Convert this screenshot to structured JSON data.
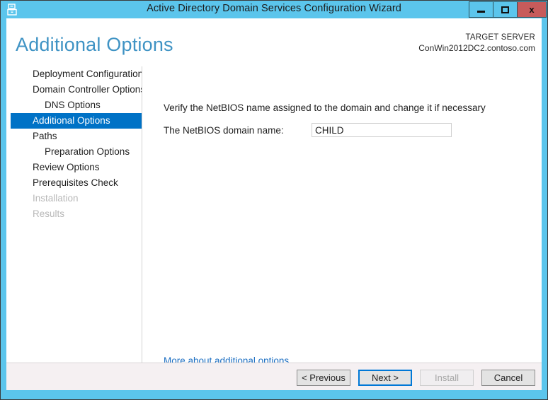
{
  "window": {
    "title": "Active Directory Domain Services Configuration Wizard",
    "icon": "server-wizard-icon",
    "controls": {
      "minimize": "minimize-icon",
      "maximize": "maximize-icon",
      "close_label": "x"
    },
    "frame_color": "#5bc5ec",
    "close_color": "#c75b5b"
  },
  "header": {
    "page_title": "Additional Options",
    "target_label": "TARGET SERVER",
    "target_server": "ConWin2012DC2.contoso.com",
    "title_color": "#3f93c4"
  },
  "sidebar": {
    "selected_color": "#0072c6",
    "items": [
      {
        "label": "Deployment Configuration",
        "indent": false,
        "state": "normal"
      },
      {
        "label": "Domain Controller Options",
        "indent": false,
        "state": "normal"
      },
      {
        "label": "DNS Options",
        "indent": true,
        "state": "normal"
      },
      {
        "label": "Additional Options",
        "indent": false,
        "state": "selected"
      },
      {
        "label": "Paths",
        "indent": false,
        "state": "normal"
      },
      {
        "label": "Preparation Options",
        "indent": true,
        "state": "normal"
      },
      {
        "label": "Review Options",
        "indent": false,
        "state": "normal"
      },
      {
        "label": "Prerequisites Check",
        "indent": false,
        "state": "normal"
      },
      {
        "label": "Installation",
        "indent": false,
        "state": "disabled"
      },
      {
        "label": "Results",
        "indent": false,
        "state": "disabled"
      }
    ]
  },
  "content": {
    "instruction": "Verify the NetBIOS name assigned to the domain and change it if necessary",
    "field_label": "The NetBIOS domain name:",
    "netbios_value": "CHILD",
    "netbios_placeholder": "",
    "more_link": "More about additional options",
    "link_color": "#1b6ec2"
  },
  "footer": {
    "buttons": [
      {
        "label": "< Previous",
        "state": "normal"
      },
      {
        "label": "Next >",
        "state": "focused"
      },
      {
        "label": "Install",
        "state": "disabled"
      },
      {
        "label": "Cancel",
        "state": "normal"
      }
    ]
  }
}
